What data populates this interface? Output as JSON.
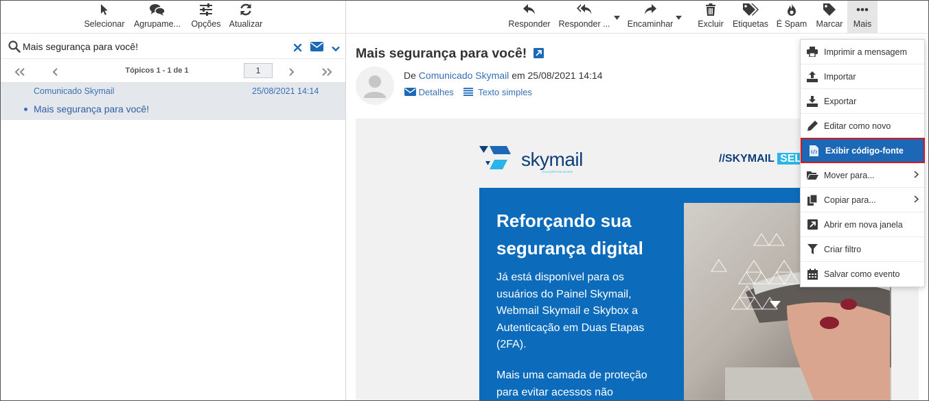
{
  "left_toolbar": {
    "select": "Selecionar",
    "group": "Agrupame...",
    "options": "Opções",
    "refresh": "Atualizar"
  },
  "search": {
    "value": "Mais segurança para você!"
  },
  "pager": {
    "info": "Tópicos 1 - 1 de 1",
    "page": "1"
  },
  "message_list": [
    {
      "from": "Comunicado Skymail",
      "date": "25/08/2021 14:14",
      "subject": "Mais segurança para você!"
    }
  ],
  "right_toolbar": {
    "reply": "Responder",
    "reply_all": "Responder ...",
    "forward": "Encaminhar",
    "delete": "Excluir",
    "tags": "Etiquetas",
    "spam": "É Spam",
    "mark": "Marcar",
    "more": "Mais"
  },
  "message": {
    "subject": "Mais segurança para você!",
    "from_prefix": "De",
    "from_name": "Comunicado Skymail",
    "date_text": "em 25/08/2021 14:14",
    "details": "Detalhes",
    "plain_text": "Texto simples"
  },
  "email_body": {
    "logo_text": "skymail",
    "logo_tagline": "SOLUÇÕES EM NUVEM",
    "header_tag": "//SKYMAIL",
    "header_tag_highlight": "SEL",
    "heading_line1": "Reforçando sua",
    "heading_line2": "segurança digital",
    "paragraph1": [
      "Já está disponível para os",
      "usuários do Painel Skymail,",
      "Webmail Skymail e Skybox a",
      "Autenticação em Duas Etapas",
      "(2FA)."
    ],
    "paragraph2": [
      "Mais uma camada de proteção",
      "para evitar acessos não"
    ]
  },
  "more_menu": {
    "items": [
      {
        "label": "Imprimir a mensagem",
        "icon": "printer-icon"
      },
      {
        "label": "Importar",
        "icon": "upload-icon"
      },
      {
        "label": "Exportar",
        "icon": "download-icon"
      },
      {
        "label": "Editar como novo",
        "icon": "pencil-icon"
      },
      {
        "label": "Exibir código-fonte",
        "icon": "code-file-icon"
      },
      {
        "label": "Mover para...",
        "icon": "folder-open-icon"
      },
      {
        "label": "Copiar para...",
        "icon": "copy-icon"
      },
      {
        "label": "Abrir em nova janela",
        "icon": "external-window-icon"
      },
      {
        "label": "Criar filtro",
        "icon": "filter-icon"
      },
      {
        "label": "Salvar como evento",
        "icon": "calendar-icon"
      }
    ],
    "highlighted_index": 4
  },
  "colors": {
    "accent": "#1d68b6",
    "link": "#376fb6",
    "banner_blue": "#0c6cbb",
    "highlight_border": "#d9161b",
    "selected_row": "#e4e8ec"
  }
}
